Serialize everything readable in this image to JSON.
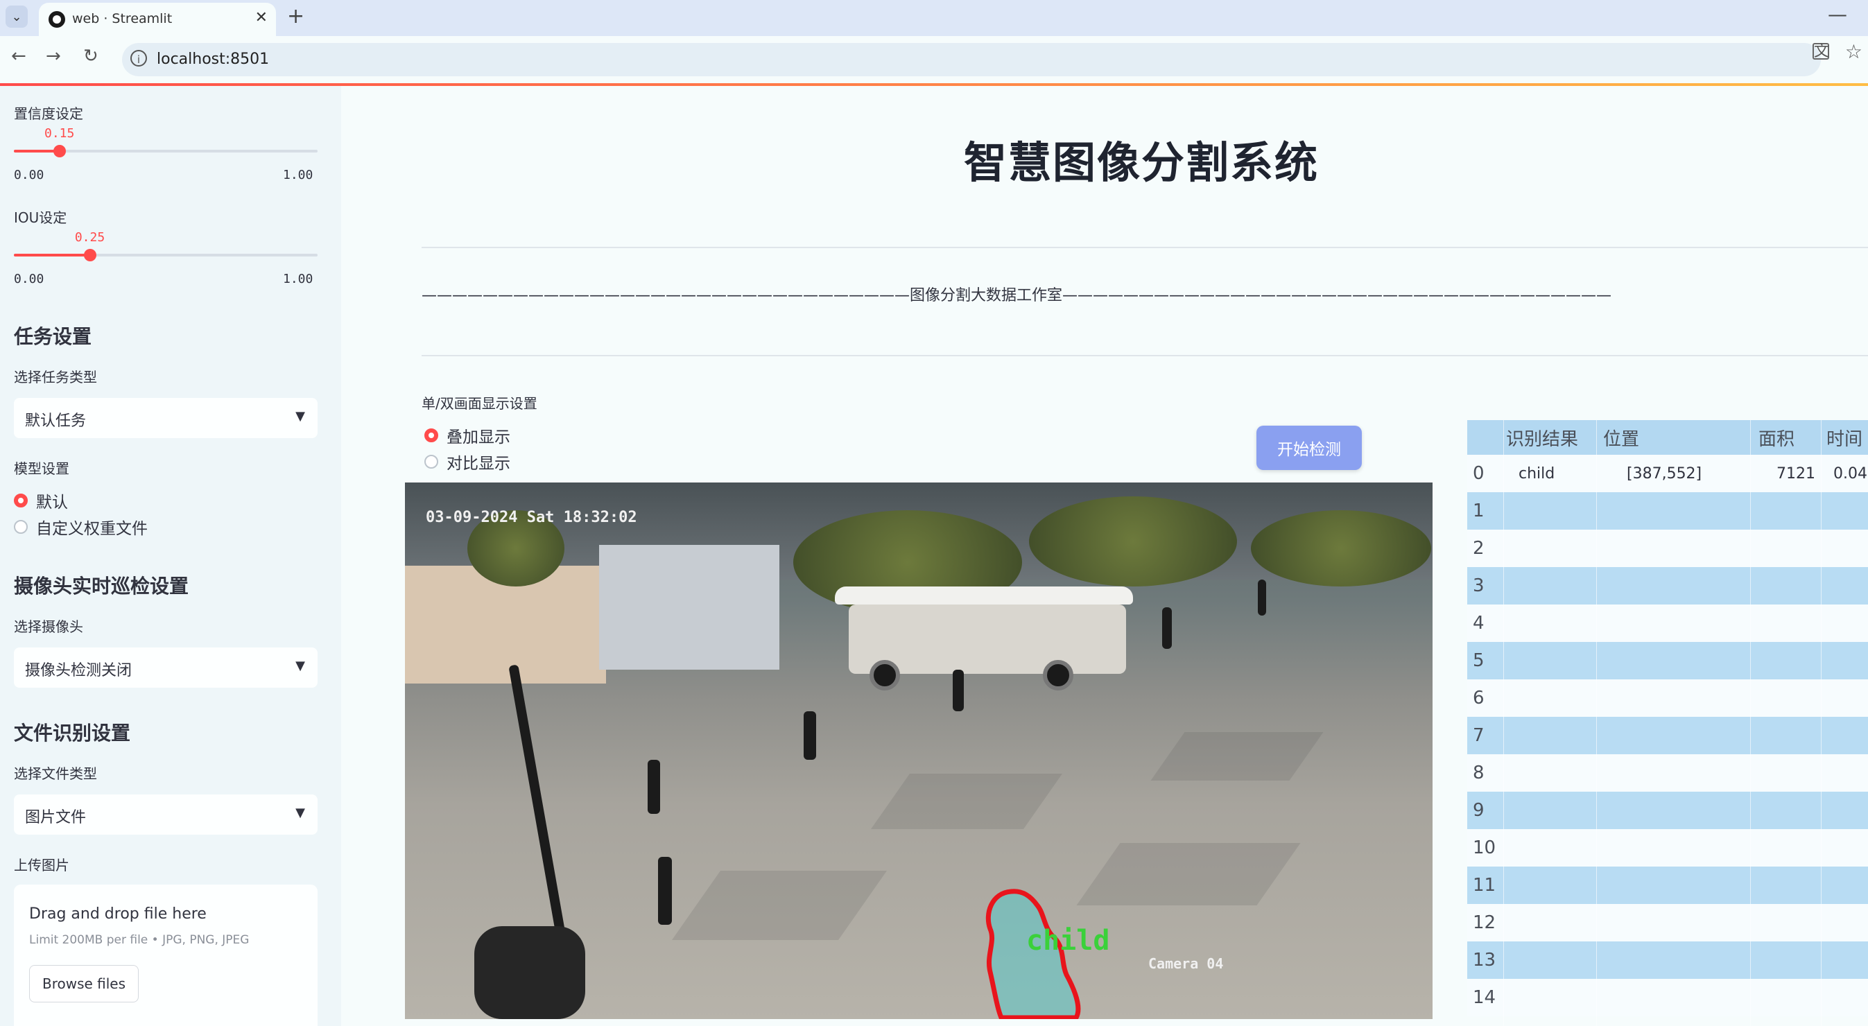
{
  "browser": {
    "tab_title": "web · Streamlit",
    "url": "localhost:8501"
  },
  "sidebar": {
    "confidence": {
      "label": "置信度设定",
      "value": "0.15",
      "min": "0.00",
      "max": "1.00",
      "fraction": 0.15
    },
    "iou": {
      "label": "IOU设定",
      "value": "0.25",
      "min": "0.00",
      "max": "1.00",
      "fraction": 0.25
    },
    "task_section": "任务设置",
    "task_type_label": "选择任务类型",
    "task_type_value": "默认任务",
    "model_label": "模型设置",
    "model_options": [
      "默认",
      "自定义权重文件"
    ],
    "model_selected": 0,
    "camera_section": "摄像头实时巡检设置",
    "camera_label": "选择摄像头",
    "camera_value": "摄像头检测关闭",
    "file_section": "文件识别设置",
    "file_type_label": "选择文件类型",
    "file_type_value": "图片文件",
    "upload_label": "上传图片",
    "upload": {
      "title": "Drag and drop file here",
      "limit": "Limit 200MB per file • JPG, PNG, JPEG",
      "button": "Browse files"
    }
  },
  "main": {
    "title": "智慧图像分割系统",
    "banner": "————————————————————————————————图像分割大数据工作室————————————————————————————————————",
    "display_mode_label": "单/双画面显示设置",
    "display_options": [
      "叠加显示",
      "对比显示"
    ],
    "display_selected": 0,
    "start_button": "开始检测",
    "camera_overlay": {
      "timestamp": "03-09-2024 Sat 18:32:02",
      "camera_id": "Camera 04",
      "detection_label": "child"
    }
  },
  "results_table": {
    "columns": [
      "识别结果",
      "位置",
      "面积",
      "时间"
    ],
    "rows": [
      {
        "index": "0",
        "result": "child",
        "position": "[387,552]",
        "area": "7121",
        "time": "0.04"
      },
      {
        "index": "1"
      },
      {
        "index": "2"
      },
      {
        "index": "3"
      },
      {
        "index": "4"
      },
      {
        "index": "5"
      },
      {
        "index": "6"
      },
      {
        "index": "7"
      },
      {
        "index": "8"
      },
      {
        "index": "9"
      },
      {
        "index": "10"
      },
      {
        "index": "11"
      },
      {
        "index": "12"
      },
      {
        "index": "13"
      },
      {
        "index": "14"
      }
    ]
  },
  "colors": {
    "accent": "#ff4b4b",
    "button": "#8aa0f0",
    "table_blue": "#b8dcf3",
    "mask_outline": "#e8141c",
    "label_green": "#3ad13a"
  }
}
